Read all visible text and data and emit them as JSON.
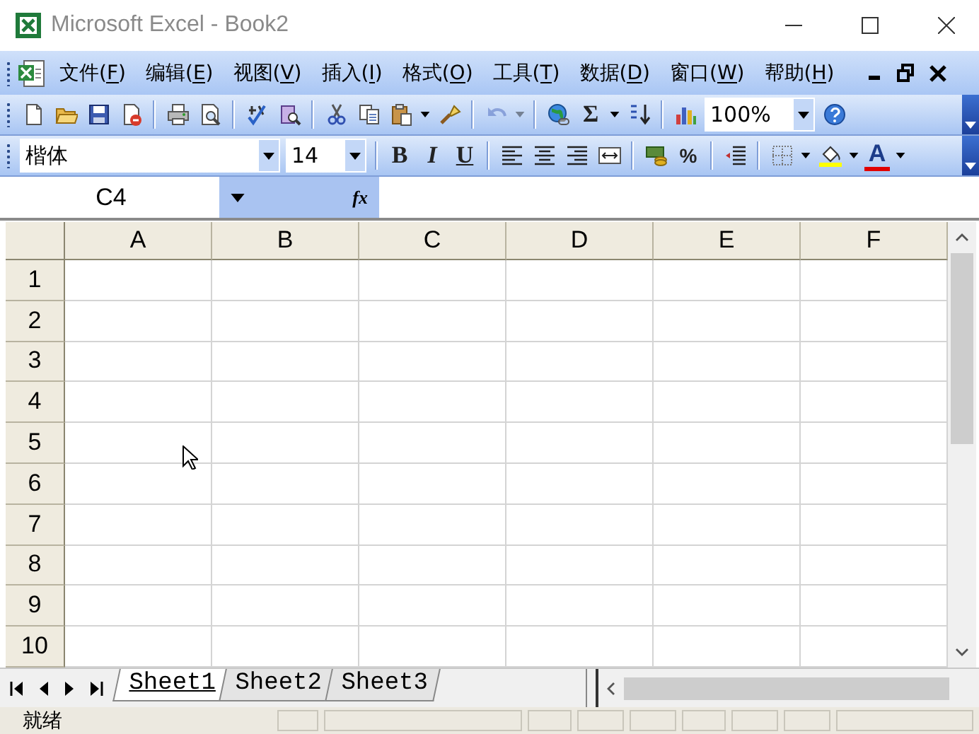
{
  "window": {
    "title": "Microsoft Excel - Book2"
  },
  "menu": [
    {
      "label": "文件(F)"
    },
    {
      "label": "编辑(E)"
    },
    {
      "label": "视图(V)"
    },
    {
      "label": "插入(I)"
    },
    {
      "label": "格式(O)"
    },
    {
      "label": "工具(T)"
    },
    {
      "label": "数据(D)"
    },
    {
      "label": "窗口(W)"
    },
    {
      "label": "帮助(H)"
    }
  ],
  "standard_toolbar": [
    {
      "kind": "icon",
      "disabled": false
    },
    {
      "kind": "icon",
      "disabled": false
    },
    {
      "kind": "icon",
      "disabled": false
    },
    {
      "kind": "icon",
      "disabled": false
    },
    {
      "kind": "separator"
    },
    {
      "kind": "icon",
      "disabled": false
    },
    {
      "kind": "icon",
      "disabled": false
    },
    {
      "kind": "separator"
    },
    {
      "kind": "icon",
      "disabled": false
    },
    {
      "kind": "icon",
      "disabled": false
    },
    {
      "kind": "separator"
    },
    {
      "kind": "icon",
      "disabled": false
    },
    {
      "kind": "icon",
      "disabled": false
    },
    {
      "kind": "icon",
      "disabled": false
    },
    {
      "kind": "dropdown",
      "disabled": false
    },
    {
      "kind": "icon",
      "disabled": false
    },
    {
      "kind": "separator"
    },
    {
      "kind": "icon",
      "disabled": true
    },
    {
      "kind": "dropdown",
      "disabled": true
    },
    {
      "kind": "separator"
    },
    {
      "kind": "icon",
      "disabled": false
    },
    {
      "kind": "sum",
      "label": "Σ",
      "disabled": false
    },
    {
      "kind": "dropdown",
      "disabled": false
    },
    {
      "kind": "icon",
      "disabled": false
    },
    {
      "kind": "separator"
    },
    {
      "kind": "icon",
      "disabled": false
    },
    {
      "kind": "combo",
      "value": "100%",
      "disabled": false
    },
    {
      "kind": "icon",
      "disabled": false
    }
  ],
  "formatting_toolbar": [
    {
      "kind": "combo",
      "value": "楷体",
      "disabled": false
    },
    {
      "kind": "combo",
      "value": "14",
      "disabled": false
    },
    {
      "kind": "separator"
    },
    {
      "kind": "bold",
      "label": "B",
      "disabled": false
    },
    {
      "kind": "italic",
      "label": "I",
      "disabled": false
    },
    {
      "kind": "underline",
      "label": "U",
      "disabled": false
    },
    {
      "kind": "separator"
    },
    {
      "kind": "icon",
      "disabled": false
    },
    {
      "kind": "icon",
      "disabled": false
    },
    {
      "kind": "icon",
      "disabled": false
    },
    {
      "kind": "icon",
      "disabled": false
    },
    {
      "kind": "separator"
    },
    {
      "kind": "icon",
      "disabled": false
    },
    {
      "kind": "percent",
      "label": "%",
      "disabled": false
    },
    {
      "kind": "separator"
    },
    {
      "kind": "icon",
      "disabled": false
    },
    {
      "kind": "separator"
    },
    {
      "kind": "icon",
      "disabled": false
    },
    {
      "kind": "dropdown",
      "disabled": false
    },
    {
      "kind": "icon",
      "disabled": false
    },
    {
      "kind": "dropdown",
      "disabled": false
    },
    {
      "kind": "font-color",
      "label": "A",
      "disabled": false
    },
    {
      "kind": "dropdown",
      "disabled": false
    }
  ],
  "formula_bar": {
    "name_box": "C4",
    "function_label": "fx"
  },
  "sheet": {
    "columns": [
      "A",
      "B",
      "C",
      "D",
      "E",
      "F"
    ],
    "rows": [
      "1",
      "2",
      "3",
      "4",
      "5",
      "6",
      "7",
      "8",
      "9",
      "10"
    ]
  },
  "sheet_tabs": [
    {
      "label": "Sheet1",
      "selected": true
    },
    {
      "label": "Sheet2",
      "selected": false
    },
    {
      "label": "Sheet3",
      "selected": false
    }
  ],
  "status_bar": {
    "text": "就绪"
  }
}
